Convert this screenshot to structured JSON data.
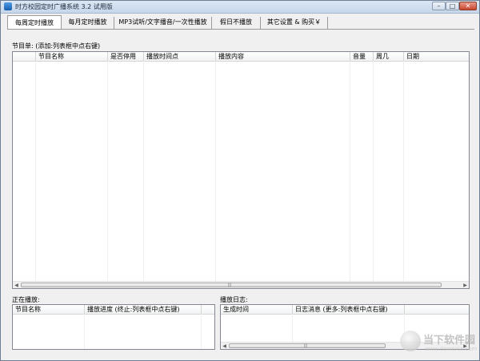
{
  "window": {
    "title": "时方校园定时广播系统 3.2 试用版",
    "controls": {
      "minimize": "–",
      "maximize": "□",
      "close": "✕"
    }
  },
  "tabs": [
    {
      "label": "每周定时播放",
      "active": true
    },
    {
      "label": "每月定时播放",
      "active": false
    },
    {
      "label": "MP3试听/文字播音/一次性播放",
      "active": false
    },
    {
      "label": "假日不播放",
      "active": false
    },
    {
      "label": "其它设置 & 购买￥",
      "active": false
    }
  ],
  "program_list": {
    "label": "节目单: (添加:列表框中点右键)",
    "columns": [
      "",
      "节目名称",
      "是否停用",
      "播放时间点",
      "播放内容",
      "音量",
      "周几",
      "日期"
    ],
    "rows": []
  },
  "now_playing": {
    "label": "正在播放:",
    "columns": [
      "节目名称",
      "播放进度 (终止:列表框中点右键)"
    ],
    "rows": []
  },
  "play_log": {
    "label": "播放日志:",
    "columns": [
      "生成时间",
      "日志消息 (更多:列表框中点右键)"
    ],
    "rows": []
  },
  "scrollbar": {
    "left_arrow": "◀",
    "right_arrow": "▶",
    "grip": "|||"
  },
  "watermark": {
    "text": "当下软件园",
    "url": "www.downxia.com",
    "icon": "downxia-logo-icon"
  }
}
